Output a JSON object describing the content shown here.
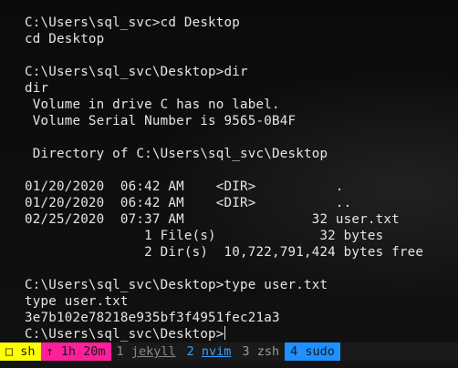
{
  "terminal": {
    "lines": [
      "C:\\Users\\sql_svc>cd Desktop",
      "cd Desktop",
      "",
      "C:\\Users\\sql_svc\\Desktop>dir",
      "dir",
      " Volume in drive C has no label.",
      " Volume Serial Number is 9565-0B4F",
      "",
      " Directory of C:\\Users\\sql_svc\\Desktop",
      "",
      "01/20/2020  06:42 AM    <DIR>          .",
      "01/20/2020  06:42 AM    <DIR>          ..",
      "02/25/2020  07:37 AM                32 user.txt",
      "               1 File(s)             32 bytes",
      "               2 Dir(s)  10,722,791,424 bytes free",
      "",
      "C:\\Users\\sql_svc\\Desktop>type user.txt",
      "type user.txt",
      "3e7b102e78218e935bf3f4951fec21a3",
      "C:\\Users\\sql_svc\\Desktop>"
    ]
  },
  "statusbar": {
    "mode": "□ sh",
    "uptime": "↑ 1h 20m",
    "windows": [
      {
        "index": "1",
        "name": "jekyll"
      },
      {
        "index": "2",
        "name": "nvim"
      },
      {
        "index": "3",
        "name": "zsh"
      },
      {
        "index": "4",
        "name": "sudo"
      }
    ]
  },
  "colors": {
    "background": "#0c0c0c",
    "text": "#e6e6e6",
    "mode_bg": "#ffff00",
    "uptime_bg": "#ff1f9a",
    "active_window": "#3aa0ff",
    "sudo_bg": "#1e90ff"
  }
}
